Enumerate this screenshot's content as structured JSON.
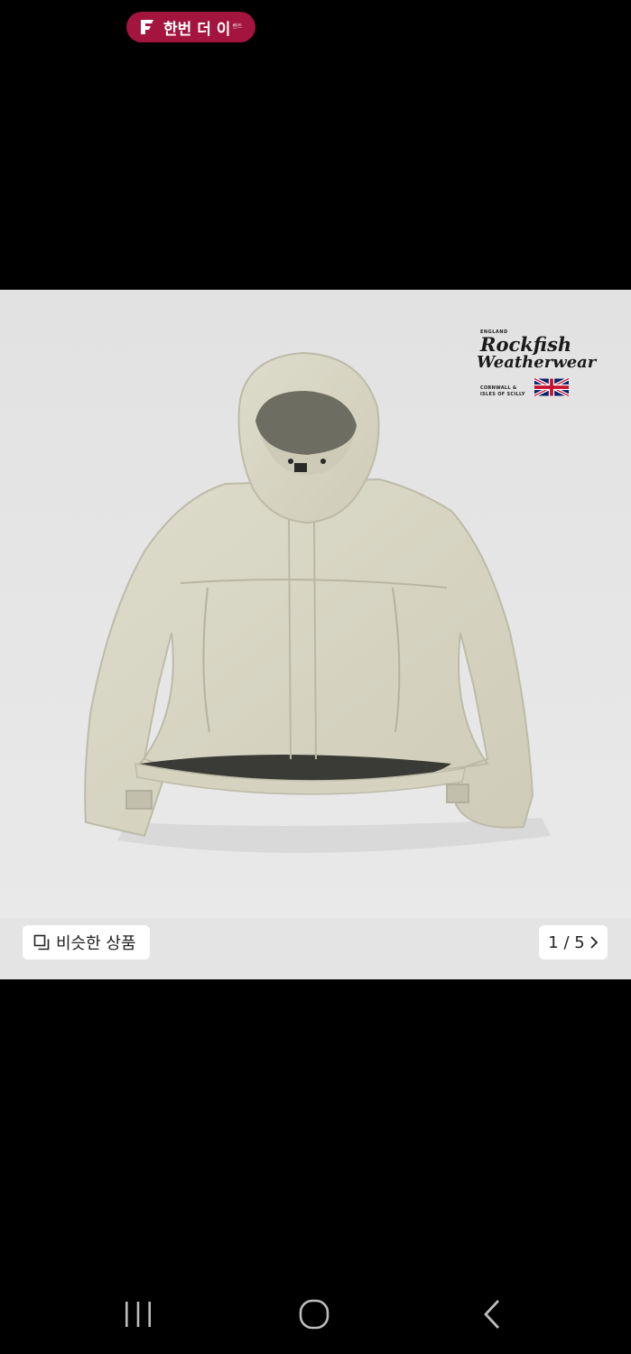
{
  "badge": {
    "label": "한번 더 이",
    "sup": "벤트",
    "icon": "f-logo-icon"
  },
  "product_image": {
    "brand_small": "ENGLAND",
    "brand_line1": "Rockfish",
    "brand_line2": "Weatherwear",
    "brand_location_1": "CORNWALL &",
    "brand_location_2": "ISLES OF SCILLY",
    "flag_icon": "uk-flag-icon",
    "jacket_color": "#d6d4c2"
  },
  "image_bar": {
    "similar_label": "비슷한 상품",
    "similar_icon": "copy-icon",
    "counter": "1 / 5",
    "next_icon": "chevron-right-icon"
  },
  "system_nav": {
    "recent_icon": "recent-apps-icon",
    "home_icon": "home-icon",
    "back_icon": "back-icon"
  },
  "colors": {
    "badge_bg": "#a3143f",
    "page_bg": "#000000",
    "viewer_bg": "#e6e6e6"
  }
}
